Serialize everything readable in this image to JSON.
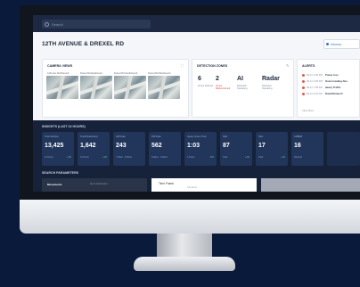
{
  "search": {
    "placeholder": "Search"
  },
  "header": {
    "title": "12TH AVENUE & DREXEL RD",
    "action_label": "Informa"
  },
  "cameras": {
    "title": "CAMERA VIEWS",
    "items": [
      {
        "label": "12th Ave Northbound"
      },
      {
        "label": "Drexel Rd Eastbound"
      },
      {
        "label": "Drexel Rd Southbound"
      },
      {
        "label": "Drexel Rd Westbound"
      }
    ]
  },
  "detection": {
    "title": "DETECTION ZONES",
    "items": [
      {
        "value": "6",
        "sub": "Zones Defined",
        "alert": false
      },
      {
        "value": "2",
        "sub": "Zones Malfunctioned",
        "alert": true
      },
      {
        "value": "AI",
        "sub": "Detection Operating",
        "alert": false
      },
      {
        "value": "Radar",
        "sub": "Detection Operating",
        "alert": false
      }
    ]
  },
  "alerts": {
    "title": "ALERTS",
    "items": [
      {
        "time": "09:11 4:06 PM",
        "name": "Power loss"
      },
      {
        "time": "09:11 3:08 PM",
        "name": "Overcrowding Ahe"
      },
      {
        "time": "09:11 7:08 AM",
        "name": "Heavy Traffic"
      },
      {
        "time": "09:11 6:30 AM",
        "name": "Flash/Strobe D"
      }
    ],
    "more": "View More"
  },
  "insights": {
    "title": "INSIGHTS (LAST 24 HOURS)",
    "stats": [
      {
        "label": "Total Vehicles",
        "value": "13,425",
        "foot": "24 Hours",
        "delta": "+3%"
      },
      {
        "label": "Total Pedestrians",
        "value": "1,642",
        "foot": "24 Hours",
        "delta": "+4%"
      },
      {
        "label": "AM Peak",
        "value": "243",
        "foot": "7:00am - 8:00am",
        "delta": ""
      },
      {
        "label": "PM Peak",
        "value": "562",
        "foot": "5:00pm - 6:00pm",
        "delta": ""
      },
      {
        "label": "Heavy Green Time",
        "value": "1:03",
        "foot": "1-Hours",
        "delta": "+5%"
      },
      {
        "label": "Split",
        "value": "87",
        "foot": "Total",
        "delta": "+3%"
      },
      {
        "label": "Split",
        "value": "17",
        "foot": "Total",
        "delta": "+1%"
      },
      {
        "label": "AMBER",
        "value": "16",
        "foot": "Nominal",
        "delta": ""
      }
    ]
  },
  "search_params": {
    "title": "SEARCH PARAMETERS",
    "left_label": "Movements",
    "left_hint": "Set to Dashboard",
    "right_label": "Time Frame",
    "right_hint": "Day/Week"
  }
}
